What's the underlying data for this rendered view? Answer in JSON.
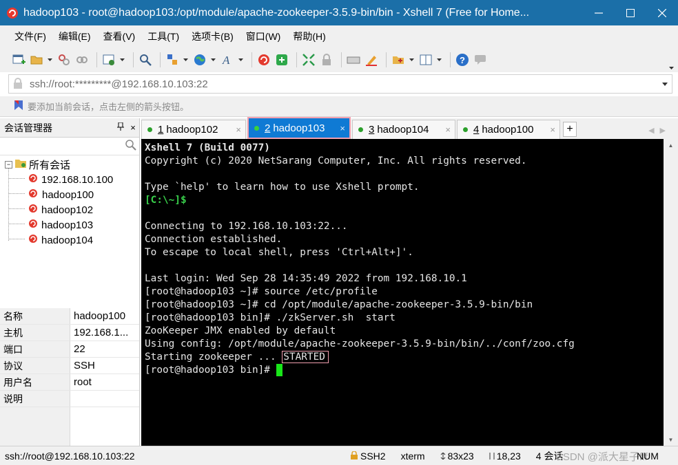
{
  "window": {
    "title": "hadoop103 - root@hadoop103:/opt/module/apache-zookeeper-3.5.9-bin/bin - Xshell 7 (Free for Home..."
  },
  "menubar": {
    "items": [
      "文件(F)",
      "编辑(E)",
      "查看(V)",
      "工具(T)",
      "选项卡(B)",
      "窗口(W)",
      "帮助(H)"
    ]
  },
  "toolbar": {
    "icons": [
      "new-session-icon",
      "open-folder-icon",
      "disconnect-icon",
      "reconnect-icon",
      "properties-icon",
      "find-icon",
      "transfer-icon",
      "globe-icon",
      "font-icon",
      "xshell-icon",
      "xftp-icon",
      "fullscreen-icon",
      "lock-icon",
      "keyboard-icon",
      "highlight-icon",
      "add-folder-icon",
      "layout-icon",
      "help-icon",
      "chat-icon"
    ]
  },
  "address": {
    "value": "ssh://root:*********@192.168.10.103:22"
  },
  "hint": {
    "text": "要添加当前会话，点击左侧的箭头按钮。"
  },
  "sidebar": {
    "title": "会话管理器",
    "pin": "ᵖ",
    "close": "×",
    "tree_root": "所有会话",
    "sessions": [
      "192.168.10.100",
      "hadoop100",
      "hadoop102",
      "hadoop103",
      "hadoop104"
    ]
  },
  "properties": {
    "rows": [
      {
        "key": "名称",
        "value": "hadoop100"
      },
      {
        "key": "主机",
        "value": "192.168.1..."
      },
      {
        "key": "端口",
        "value": "22"
      },
      {
        "key": "协议",
        "value": "SSH"
      },
      {
        "key": "用户名",
        "value": "root"
      },
      {
        "key": "说明",
        "value": ""
      }
    ]
  },
  "tabs": [
    {
      "num": "1",
      "label": "hadoop102",
      "close": "×"
    },
    {
      "num": "2",
      "label": "hadoop103",
      "close": "×"
    },
    {
      "num": "3",
      "label": "hadoop104",
      "close": "×"
    },
    {
      "num": "4",
      "label": "hadoop100",
      "close": "×"
    }
  ],
  "tab_add": "+",
  "terminal": {
    "lines": [
      "Xshell 7 (Build 0077)",
      "Copyright (c) 2020 NetSarang Computer, Inc. All rights reserved.",
      "",
      "Type `help' to learn how to use Xshell prompt.",
      "[C:\\~]$",
      "",
      "Connecting to 192.168.10.103:22...",
      "Connection established.",
      "To escape to local shell, press 'Ctrl+Alt+]'.",
      "",
      "Last login: Wed Sep 28 14:35:49 2022 from 192.168.10.1",
      "[root@hadoop103 ~]# source /etc/profile",
      "[root@hadoop103 ~]# cd /opt/module/apache-zookeeper-3.5.9-bin/bin",
      "[root@hadoop103 bin]# ./zkServer.sh  start",
      "ZooKeeper JMX enabled by default",
      "Using config: /opt/module/apache-zookeeper-3.5.9-bin/bin/../conf/zoo.cfg",
      "Starting zookeeper ... ",
      "[root@hadoop103 bin]# "
    ],
    "started": "STARTED"
  },
  "status": {
    "connection": "ssh://root@192.168.10.103:22",
    "protocol": "SSH2",
    "term": "xterm",
    "size": "83x23",
    "pos": "18,23",
    "sessions": "4 会话",
    "watermark": "CSDN @派大星子fff",
    "num": "NUM"
  },
  "colors": {
    "titlebar": "#1b6fa8",
    "active_tab": "#0f7ad4",
    "highlight_box": "#f2a0b0",
    "cursor": "#19e619"
  }
}
